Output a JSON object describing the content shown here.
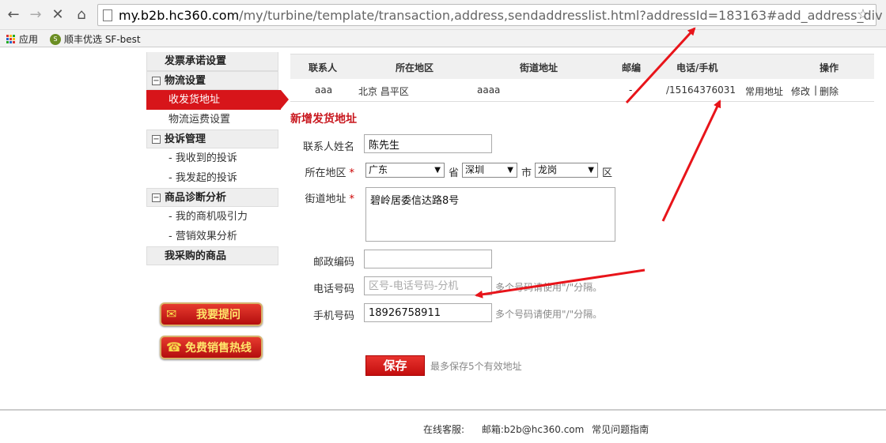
{
  "browser": {
    "url_host": "my.b2b.hc360.com",
    "url_path": "/my/turbine/template/transaction,address,sendaddresslist.html?addressId=183163#add_address_div",
    "bookmarks": [
      {
        "label": "应用"
      },
      {
        "label": "顺丰优选 SF-best"
      }
    ]
  },
  "sidebar": {
    "top_item": "发票承诺设置",
    "groups": [
      {
        "title": "物流设置",
        "items": [
          "收发货地址",
          "物流运费设置"
        ],
        "active": 0
      },
      {
        "title": "投诉管理",
        "items": [
          "- 我收到的投诉",
          "- 我发起的投诉"
        ]
      },
      {
        "title": "商品诊断分析",
        "items": [
          "- 我的商机吸引力",
          "- 营销效果分析"
        ]
      }
    ],
    "bottom_item": "我采购的商品",
    "promo": [
      "我要提问",
      "免费销售热线"
    ]
  },
  "address_table": {
    "headers": [
      "联系人",
      "所在地区",
      "街道地址",
      "邮编",
      "电话/手机",
      "操作"
    ],
    "row": {
      "contact": "aaa",
      "region": "北京 昌平区",
      "street": "aaaa",
      "postcode": "-",
      "phone": "/15164376031",
      "default": "常用地址",
      "edit": "修改",
      "sep": "|",
      "delete": "删除"
    }
  },
  "form": {
    "title": "新增发货地址",
    "contact_label": "联系人姓名",
    "contact_value": "陈先生",
    "region_label": "所在地区",
    "required": "*",
    "province": "广东",
    "province_unit": "省",
    "city": "深圳",
    "city_unit": "市",
    "district": "龙岗",
    "district_unit": "区",
    "street_label": "街道地址",
    "street_value": "碧岭居委信达路8号",
    "postcode_label": "邮政编码",
    "postcode_value": "",
    "phone_label": "电话号码",
    "phone_placeholder": "区号-电话号码-分机",
    "phone_hint": "多个号码请使用\"/\"分隔。",
    "mobile_label": "手机号码",
    "mobile_value": "18926758911",
    "mobile_hint": "多个号码请使用\"/\"分隔。",
    "save_label": "保存",
    "save_hint": "最多保存5个有效地址"
  },
  "footer": {
    "online": "在线客服:",
    "email": "邮箱:b2b@hc360.com",
    "guide": "常见问题指南"
  },
  "colors": {
    "accent": "#d7151a",
    "link": "#1a5fb4",
    "annotation": "#e8141a"
  }
}
